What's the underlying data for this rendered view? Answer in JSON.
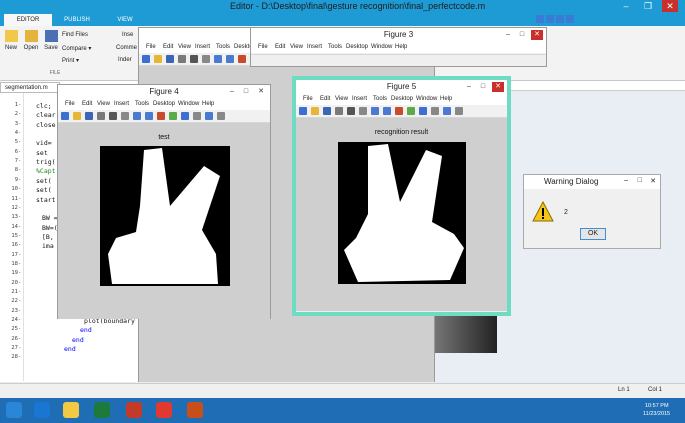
{
  "window": {
    "title": "Editor - D:\\Desktop\\final\\gesture recognition\\final_perfectcode.m",
    "ribbon_tabs": [
      "EDITOR",
      "PUBLISH",
      "VIEW"
    ],
    "ribbon": {
      "new": "New",
      "open": "Open",
      "save": "Save",
      "find_files": "Find Files",
      "compare": "Compare ▾",
      "print": "Print ▾",
      "file_group": "FILE",
      "insert_label": "Inse",
      "comment_label": "Comme",
      "indent_label": "Inder"
    }
  },
  "editor": {
    "tab_label": "segmentation.m",
    "line_numbers": [
      "1",
      "2",
      "3",
      "4",
      "5",
      "6",
      "7",
      "8",
      "9",
      "10",
      "11",
      "12",
      "13",
      "14",
      "15",
      "16",
      "17",
      "18",
      "19",
      "20",
      "21",
      "22",
      "23",
      "24",
      "25",
      "26",
      "27",
      "28"
    ],
    "code": [
      {
        "text": "clc;",
        "line": 1
      },
      {
        "text": "clear",
        "line": 2
      },
      {
        "text": "close",
        "line": 3
      },
      {
        "text": "vid=",
        "line": 5
      },
      {
        "text": "set",
        "line": 6
      },
      {
        "text": "trig(",
        "line": 7
      },
      {
        "text": "%Capt",
        "line": 8
      },
      {
        "text": "set(",
        "line": 9
      },
      {
        "text": "set(",
        "line": 10
      },
      {
        "text": "start",
        "line": 11
      },
      {
        "text": "BW =",
        "line": 13
      },
      {
        "text": "BW=(",
        "line": 14
      },
      {
        "text": "[B,",
        "line": 15
      },
      {
        "text": "ima",
        "line": 16
      },
      {
        "text": "plot(boundary",
        "line": 24
      },
      {
        "text": "end",
        "line": 25
      },
      {
        "text": "end",
        "line": 26
      },
      {
        "text": "end",
        "line": 27
      }
    ]
  },
  "figures": {
    "fig3": {
      "title": "Figure 3"
    },
    "fig4": {
      "title": "Figure 4",
      "axes_title": "test"
    },
    "fig5": {
      "title": "Figure 5",
      "axes_title": "recognition result"
    },
    "menu": [
      "File",
      "Edit",
      "View",
      "Insert",
      "Tools",
      "Desktop",
      "Window",
      "Help"
    ]
  },
  "dialog": {
    "title": "Warning Dialog",
    "message": "2",
    "ok_label": "OK"
  },
  "status": {
    "ln": "Ln 1",
    "col": "Col 1"
  },
  "taskbar": {
    "time": "10:57 PM",
    "date": "11/23/2015"
  },
  "colors": {
    "title_blue": "#1e9bd4",
    "fig5_border": "#6ddcc0",
    "close_red": "#c9302c",
    "warning_yellow": "#f5c518"
  }
}
